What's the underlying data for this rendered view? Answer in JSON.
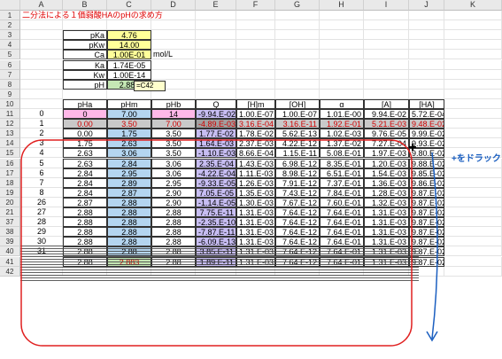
{
  "columns": [
    "A",
    "B",
    "C",
    "D",
    "E",
    "F",
    "G",
    "H",
    "I",
    "J",
    "K",
    "L"
  ],
  "row_numbers": [
    "1",
    "2",
    "3",
    "4",
    "5",
    "6",
    "7",
    "8",
    "9",
    "10",
    "11",
    "12",
    "13",
    "14",
    "15",
    "16",
    "17",
    "18",
    "19",
    "20",
    "21",
    "37",
    "38",
    "39",
    "40",
    "41",
    "42"
  ],
  "title": "二分法による１価弱酸HAのpHの求め方",
  "params": [
    {
      "label": "pKa",
      "value": "4.76"
    },
    {
      "label": "pKw",
      "value": "14.00"
    },
    {
      "label": "Ca",
      "value": "1.00E-01",
      "unit": "mol/L"
    },
    {
      "label": "Ka",
      "value": "1.74E-05"
    },
    {
      "label": "Kw",
      "value": "1.00E-14"
    },
    {
      "label": "pH",
      "value": "2.883"
    }
  ],
  "formula_ref": "=C42",
  "table_headers": [
    "pHa",
    "pHm",
    "pHb",
    "Q",
    "[H]m",
    "[OH]",
    "α",
    "[A]",
    "[HA]"
  ],
  "iteration_labels": [
    "0",
    "1",
    "2",
    "3",
    "4",
    "5",
    "6",
    "7",
    "8",
    "26",
    "27",
    "28",
    "29",
    "30",
    "31"
  ],
  "rows": [
    [
      "0",
      "7.00",
      "14",
      "-9.94.E-02",
      "1.00.E-07",
      "1.00.E-07",
      "1.01.E-00",
      "9.94.E-02",
      "5.72.E-04"
    ],
    [
      "0.00",
      "3.50",
      "7.00",
      "-4.89.E-03",
      "3.16.E-04",
      "3.16.E-11",
      "1.92.E-01",
      "5.21.E-03",
      "9.48.E-02"
    ],
    [
      "0.00",
      "1.75",
      "3.50",
      "1.77.E-02",
      "1.78.E-02",
      "5.62.E-13",
      "1.02.E-03",
      "9.76.E-05",
      "9.99.E-02"
    ],
    [
      "1.75",
      "2.63",
      "3.50",
      "1.64.E-03",
      "2.37.E-03",
      "4.22.E-12",
      "1.37.E-02",
      "7.27.E-04",
      "9.93.E-02"
    ],
    [
      "2.63",
      "3.06",
      "3.50",
      "-1.10.E-03",
      "8.66.E-04",
      "1.15.E-11",
      "5.08.E-01",
      "1.97.E-03",
      "9.80.E-02"
    ],
    [
      "2.63",
      "2.84",
      "3.06",
      "2.35.E-04",
      "1.43.E-03",
      "6.98.E-12",
      "8.35.E-01",
      "1.20.E-03",
      "9.88.E-02"
    ],
    [
      "2.84",
      "2.95",
      "3.06",
      "-4.22.E-04",
      "1.11.E-03",
      "8.98.E-12",
      "6.51.E-01",
      "1.54.E-03",
      "9.85.E-02"
    ],
    [
      "2.84",
      "2.89",
      "2.95",
      "-9.33.E-05",
      "1.26.E-03",
      "7.91.E-12",
      "7.37.E-01",
      "1.36.E-03",
      "9.86.E-02"
    ],
    [
      "2.84",
      "2.87",
      "2.90",
      "7.05.E-05",
      "1.35.E-03",
      "7.43.E-12",
      "7.84.E-01",
      "1.28.E-03",
      "9.87.E-02"
    ],
    [
      "2.87",
      "2.88",
      "2.90",
      "-1.14.E-05",
      "1.30.E-03",
      "7.67.E-12",
      "7.60.E-01",
      "1.32.E-03",
      "9.87.E-02"
    ],
    [
      "2.88",
      "2.88",
      "2.88",
      "7.75.E-11",
      "1.31.E-03",
      "7.64.E-12",
      "7.64.E-01",
      "1.31.E-03",
      "9.87.E-02"
    ],
    [
      "2.88",
      "2.88",
      "2.88",
      "-2.35.E-10",
      "1.31.E-03",
      "7.64.E-12",
      "7.64.E-01",
      "1.31.E-03",
      "9.87.E-02"
    ],
    [
      "2.88",
      "2.88",
      "2.88",
      "-7.87.E-11",
      "1.31.E-03",
      "7.64.E-12",
      "7.64.E-01",
      "1.31.E-03",
      "9.87.E-02"
    ],
    [
      "2.88",
      "2.88",
      "2.88",
      "-6.09.E-13",
      "1.31.E-03",
      "7.64.E-12",
      "7.64.E-01",
      "1.31.E-03",
      "9.87.E-02"
    ],
    [
      "2.88",
      "2.88",
      "2.88",
      "3.85.E-11",
      "1.31.E-03",
      "7.64.E-12",
      "7.64.E-01",
      "1.31.E-03",
      "9.87.E-02"
    ],
    [
      "2.88",
      "2.883",
      "2.88",
      "1.89.E-11",
      "1.31.E-03",
      "7.64.E-12",
      "7.64.E-01",
      "1.31.E-03",
      "9.87.E-02"
    ]
  ],
  "drag_hint": "+をドラック",
  "colors": {
    "annotation": "#1b5fc0",
    "highlight_red": "#d00000",
    "loop_outline": "#e02020"
  }
}
